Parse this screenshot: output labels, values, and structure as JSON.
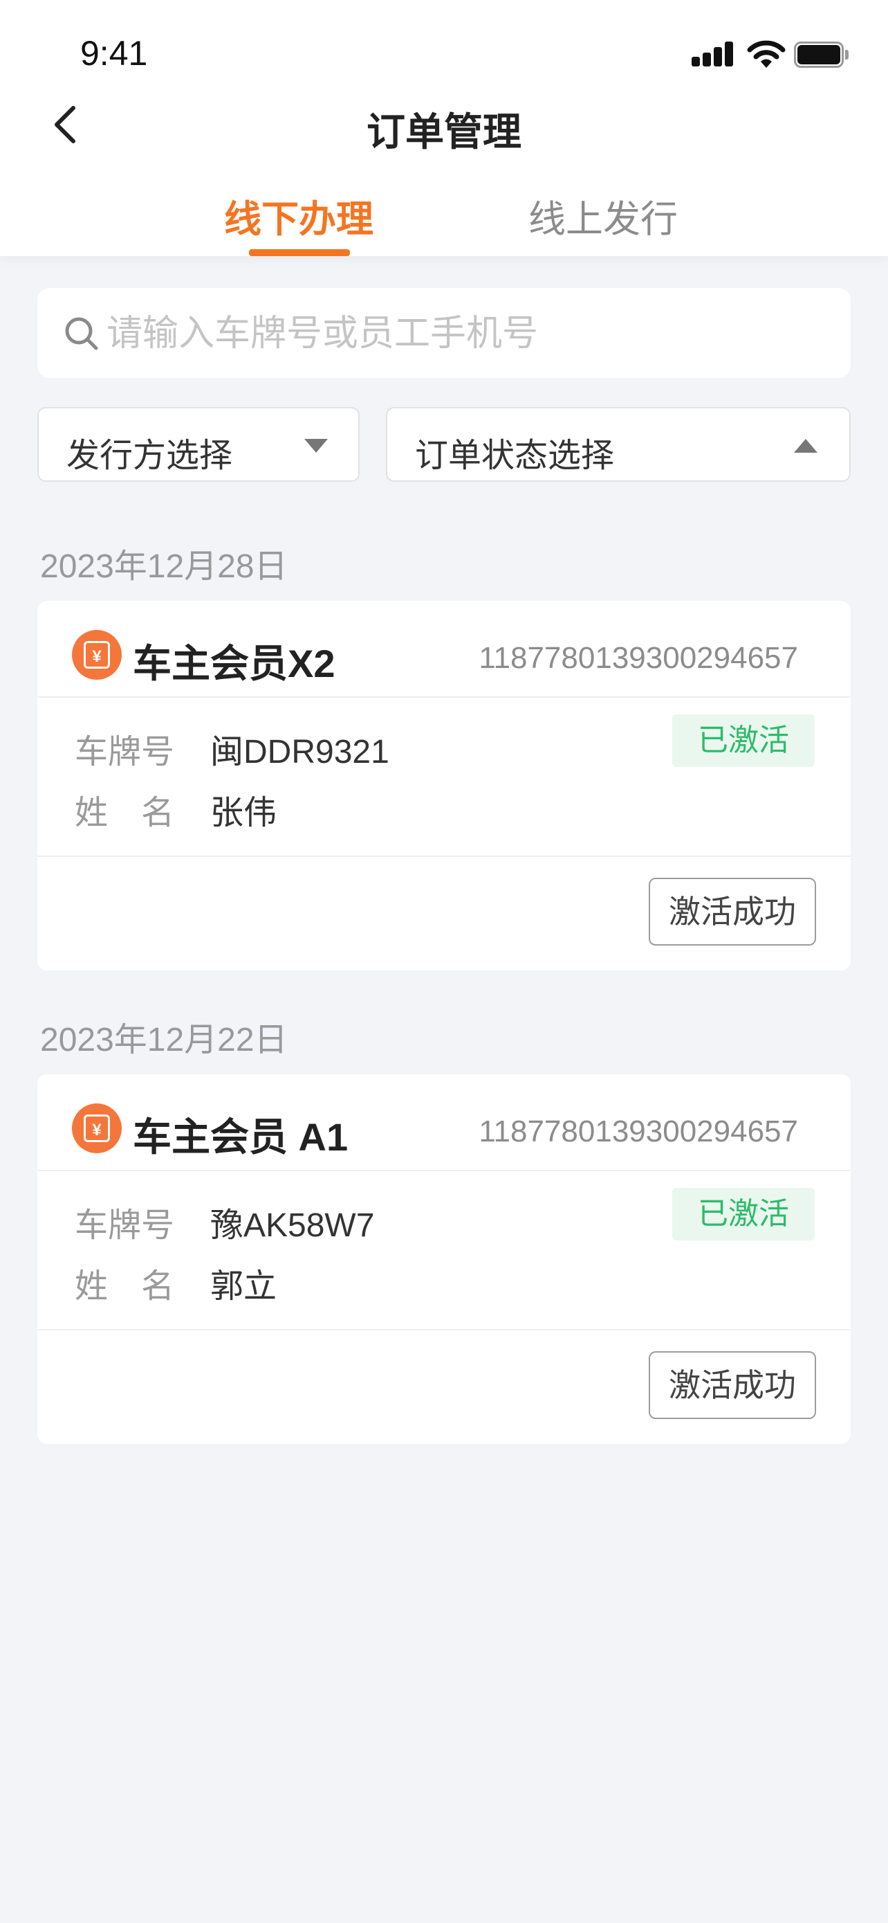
{
  "status_bar": {
    "time": "9:41"
  },
  "header": {
    "title": "订单管理"
  },
  "tabs": [
    {
      "label": "线下办理",
      "active": true
    },
    {
      "label": "线上发行",
      "active": false
    }
  ],
  "search": {
    "placeholder": "请输入车牌号或员工手机号",
    "value": ""
  },
  "filters": {
    "issuer": {
      "label": "发行方选择",
      "icon": "caret-down-icon"
    },
    "status": {
      "label": "订单状态选择",
      "icon": "caret-up-icon"
    }
  },
  "orders": [
    {
      "date": "2023年12月28日",
      "product": "车主会员X2",
      "order_no": "1187780139300294657",
      "plate_label": "车牌号",
      "plate": "闽DDR9321",
      "name_label": "姓　名",
      "name": "张伟",
      "badge": "已激活",
      "action": "激活成功"
    },
    {
      "date": "2023年12月22日",
      "product": "车主会员 A1",
      "order_no": "1187780139300294657",
      "plate_label": "车牌号",
      "plate": "豫AK58W7",
      "name_label": "姓　名",
      "name": "郭立",
      "badge": "已激活",
      "action": "激活成功"
    }
  ],
  "colors": {
    "accent": "#f47521",
    "background": "#f3f4f8",
    "badge_text": "#2dbb6a",
    "badge_bg": "#eaf7ef",
    "coupon_icon": "#f4763a"
  }
}
